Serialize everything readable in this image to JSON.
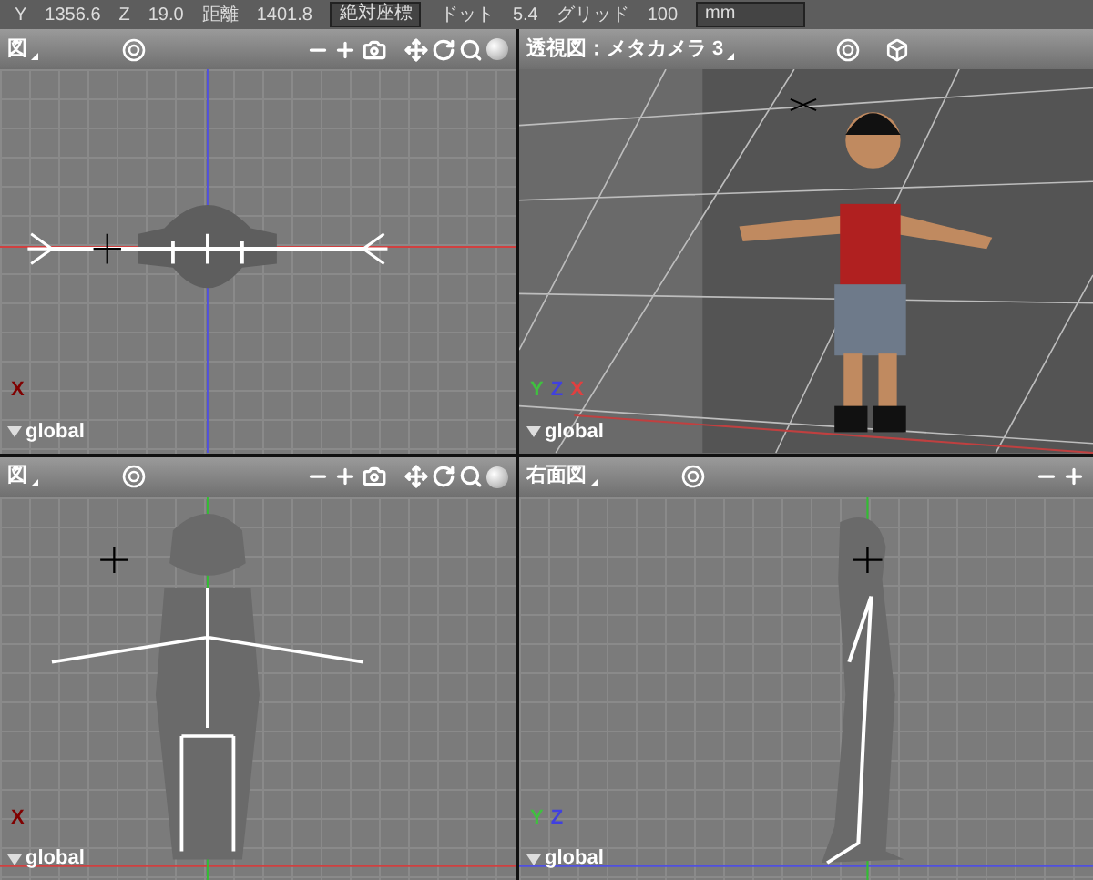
{
  "status_bar": {
    "fields": [
      {
        "label": "Y",
        "value": "1356.6"
      },
      {
        "label": "Z",
        "value": "19.0"
      },
      {
        "label": "距離",
        "value": "1401.8"
      }
    ],
    "coord_mode": "絶対座標",
    "dot": {
      "label": "ドット",
      "value": "5.4"
    },
    "grid": {
      "label": "グリッド",
      "value": "100"
    },
    "unit": "mm"
  },
  "viewports": [
    {
      "kind": "top",
      "title": "図",
      "space": "global",
      "axes": [
        {
          "label": "X",
          "color": "#800000"
        }
      ]
    },
    {
      "kind": "perspective",
      "title": "透視図：メタカメラ 3",
      "space": "global",
      "axes": [
        {
          "label": "Y",
          "color": "#40c040"
        },
        {
          "label": "Z",
          "color": "#4040e0"
        },
        {
          "label": "X",
          "color": "#e04040"
        }
      ]
    },
    {
      "kind": "front",
      "title": "図",
      "space": "global",
      "axes": [
        {
          "label": "X",
          "color": "#800000"
        }
      ]
    },
    {
      "kind": "side",
      "title": "右面図",
      "space": "global",
      "axes": [
        {
          "label": "Y",
          "color": "#40c040"
        },
        {
          "label": "Z",
          "color": "#4040e0"
        }
      ]
    }
  ]
}
